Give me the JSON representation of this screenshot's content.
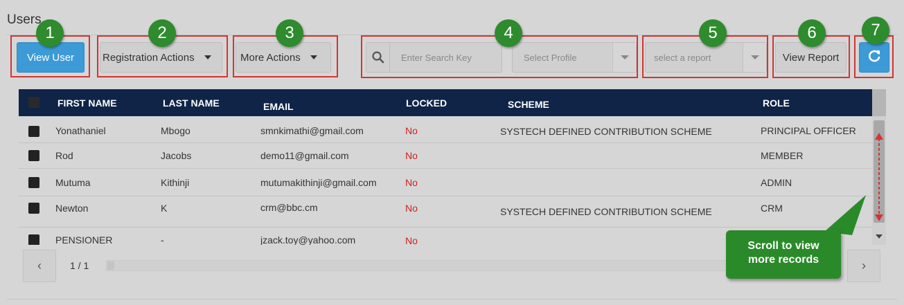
{
  "page": {
    "title": "Users"
  },
  "toolbar": {
    "view_user_label": "View User",
    "registration_actions_label": "Registration Actions",
    "more_actions_label": "More Actions",
    "search_placeholder": "Enter Search Key",
    "profile_placeholder": "Select Profile",
    "report_placeholder": "select a report",
    "view_report_label": "View Report"
  },
  "callouts": [
    "1",
    "2",
    "3",
    "4",
    "5",
    "6",
    "7"
  ],
  "table": {
    "headers": {
      "first_name": "FIRST NAME",
      "last_name": "LAST NAME",
      "email": "EMAIL",
      "locked": "LOCKED",
      "scheme": "SCHEME",
      "role": "ROLE"
    },
    "rows": [
      {
        "first_name": "Yonathaniel",
        "last_name": "Mbogo",
        "email": "smnkimathi@gmail.com",
        "locked": "No",
        "scheme": "SYSTECH DEFINED CONTRIBUTION SCHEME",
        "role": "PRINCIPAL OFFICER"
      },
      {
        "first_name": "Rod",
        "last_name": "Jacobs",
        "email": "demo11@gmail.com",
        "locked": "No",
        "scheme": "",
        "role": "MEMBER"
      },
      {
        "first_name": "Mutuma",
        "last_name": "Kithinji",
        "email": "mutumakithinji@gmail.com",
        "locked": "No",
        "scheme": "",
        "role": "ADMIN"
      },
      {
        "first_name": "Newton",
        "last_name": "K",
        "email": "crm@bbc.cm",
        "locked": "No",
        "scheme": "SYSTECH DEFINED CONTRIBUTION SCHEME",
        "role": "CRM"
      },
      {
        "first_name": "PENSIONER",
        "last_name": "-",
        "email": "jzack.toy@yahoo.com",
        "locked": "No",
        "scheme": "",
        "role": ""
      }
    ]
  },
  "pager": {
    "page_info": "1 / 1",
    "prev_icon": "chevron-left-icon",
    "next_icon": "chevron-right-icon"
  },
  "tooltip": {
    "line1": "Scroll to view",
    "line2": "more records"
  },
  "colors": {
    "primary": "#3c9ad6",
    "header_bg": "#0f2447",
    "callout_red": "#d23434",
    "badge_green": "#2e8b2e",
    "locked_no": "#d02020"
  }
}
